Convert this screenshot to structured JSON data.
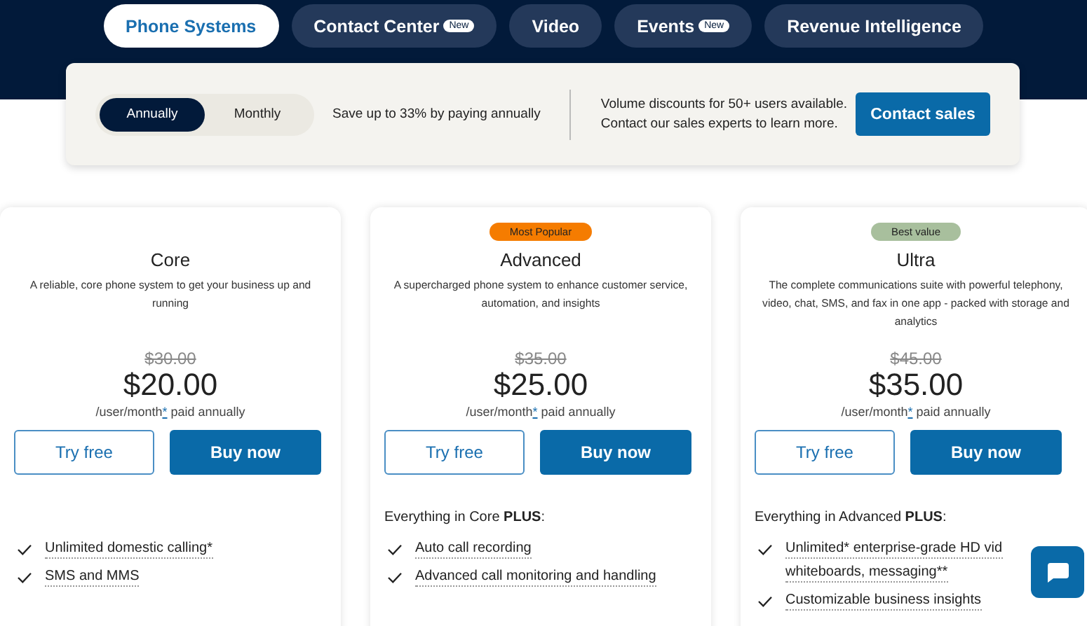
{
  "tabs": [
    {
      "label": "Phone Systems",
      "selected": true
    },
    {
      "label": "Contact Center",
      "badge": "New",
      "selected": false
    },
    {
      "label": "Video",
      "selected": false
    },
    {
      "label": "Events",
      "badge": "New",
      "selected": false
    },
    {
      "label": "Revenue Intelligence",
      "selected": false
    }
  ],
  "billing": {
    "options": [
      {
        "label": "Annually",
        "selected": true
      },
      {
        "label": "Monthly",
        "selected": false
      }
    ],
    "note": "Save up to 33% by paying annually",
    "volume_text": "Volume discounts for 50+ users available. Contact our sales experts to learn more.",
    "contact_button": "Contact sales"
  },
  "plans": [
    {
      "name": "Core",
      "description": "A reliable, core phone system to get your business up and running",
      "old_price": "$30.00",
      "price": "$20.00",
      "period": "/user/month",
      "period_mark": "*",
      "billing": "paid annually",
      "try_button": "Try free",
      "buy_button": "Buy now",
      "features": [
        {
          "lines": [
            "Unlimited domestic calling*"
          ]
        },
        {
          "lines": [
            "SMS and MMS"
          ]
        }
      ]
    },
    {
      "name": "Advanced",
      "badge": {
        "label": "Most Popular",
        "color": "#f57c00"
      },
      "description": "A supercharged phone system to enhance customer service, automation, and insights",
      "old_price": "$35.00",
      "price": "$25.00",
      "period": "/user/month",
      "period_mark": "*",
      "billing": "paid annually",
      "try_button": "Try free",
      "buy_button": "Buy now",
      "features_heading": "Everything in Core **PLUS**:",
      "features": [
        {
          "lines": [
            "Auto call recording"
          ]
        },
        {
          "lines": [
            "Advanced call monitoring and handling"
          ]
        }
      ]
    },
    {
      "name": "Ultra",
      "badge": {
        "label": "Best value",
        "color": "#a8bf9d"
      },
      "description": "The complete communications suite with powerful telephony, video, chat, SMS, and fax in one app - packed with storage and analytics",
      "old_price": "$45.00",
      "price": "$35.00",
      "period": "/user/month",
      "period_mark": "*",
      "billing": "paid annually",
      "try_button": "Try free",
      "buy_button": "Buy now",
      "features_heading": "Everything in Advanced **PLUS**:",
      "features": [
        {
          "lines": [
            "Unlimited* enterprise-grade HD vid",
            "whiteboards, messaging**"
          ]
        },
        {
          "lines": [
            "Customizable business insights"
          ]
        }
      ]
    }
  ]
}
